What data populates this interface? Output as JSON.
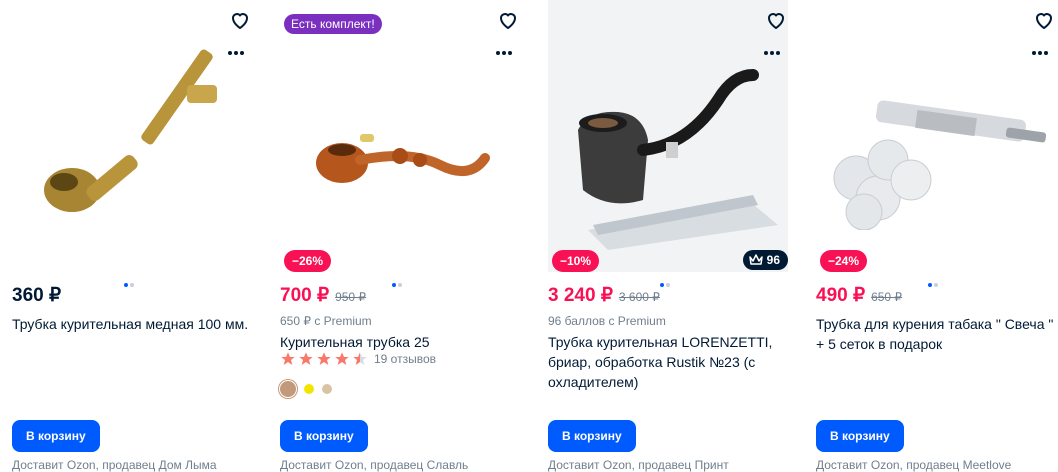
{
  "colors": {
    "sale": "#f91155",
    "accent": "#005bff",
    "set_badge": "#7b2fbe"
  },
  "products": [
    {
      "price": "360 ₽",
      "title": "Трубка курительная медная 100 мм.",
      "cart_label": "В корзину",
      "delivery": "Доставит Ozon, продавец Дом Лыма"
    },
    {
      "badge": "Есть комплект!",
      "discount": "−26%",
      "price": "700 ₽",
      "old_price": "950 ₽",
      "premium_note": "650 ₽ с Premium",
      "title": "Курительная трубка 25",
      "rating": 4.5,
      "reviews": "19 отзывов",
      "swatches": [
        "#c29a7b",
        "#f4e500",
        "#d9c3a5"
      ],
      "cart_label": "В корзину",
      "delivery": "Доставит Ozon, продавец Славль"
    },
    {
      "discount": "−10%",
      "premium_points": "96",
      "price": "3 240 ₽",
      "old_price": "3 600 ₽",
      "premium_note": "96 баллов с Premium",
      "title": "Трубка курительная LORENZETTI, бриар, обработка Rustik №23 (с охладителем)",
      "cart_label": "В корзину",
      "delivery": "Доставит Ozon, продавец Принт"
    },
    {
      "discount": "−24%",
      "price": "490 ₽",
      "old_price": "650 ₽",
      "title": "Трубка для курения табака \" Свеча \" + 5 сеток в подарок",
      "cart_label": "В корзину",
      "delivery": "Доставит Ozon, продавец Meetlove"
    }
  ]
}
